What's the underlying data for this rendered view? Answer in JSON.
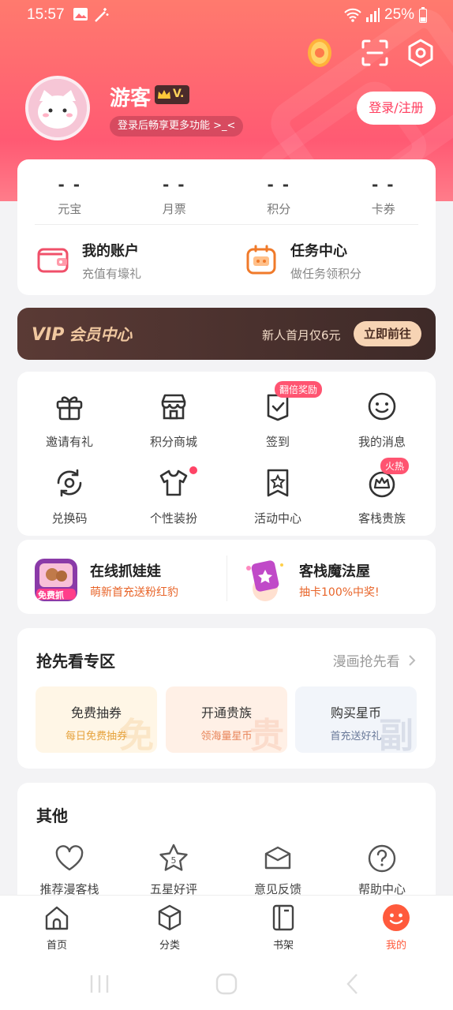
{
  "status": {
    "time": "15:57",
    "battery": "25%"
  },
  "profile": {
    "name": "游客",
    "vip_badge": "V.",
    "subtitle": "登录后畅享更多功能 >_<",
    "login_button": "登录/注册"
  },
  "stats": [
    {
      "value": "- -",
      "label": "元宝"
    },
    {
      "value": "- -",
      "label": "月票"
    },
    {
      "value": "- -",
      "label": "积分"
    },
    {
      "value": "- -",
      "label": "卡券"
    }
  ],
  "accounts": [
    {
      "title": "我的账户",
      "subtitle": "充值有壕礼"
    },
    {
      "title": "任务中心",
      "subtitle": "做任务领积分"
    }
  ],
  "vip": {
    "title": "会员中心",
    "logo": "VIP",
    "promo": "新人首月仅6元",
    "button": "立即前往"
  },
  "grid": [
    {
      "label": "邀请有礼",
      "icon": "gift-icon"
    },
    {
      "label": "积分商城",
      "icon": "store-icon"
    },
    {
      "label": "签到",
      "icon": "checkin-icon",
      "tag": "翻倍奖励"
    },
    {
      "label": "我的消息",
      "icon": "smile-message-icon"
    },
    {
      "label": "兑换码",
      "icon": "redeem-icon"
    },
    {
      "label": "个性装扮",
      "icon": "tshirt-icon"
    },
    {
      "label": "活动中心",
      "icon": "star-bookmark-icon"
    },
    {
      "label": "客栈贵族",
      "icon": "crown-icon",
      "tag": "火热"
    }
  ],
  "promos": [
    {
      "title": "在线抓娃娃",
      "subtitle": "萌新首充送粉红豹",
      "badge": "免费抓"
    },
    {
      "title": "客栈魔法屋",
      "subtitle": "抽卡100%中奖!"
    }
  ],
  "preview": {
    "title": "抢先看专区",
    "more": "漫画抢先看",
    "tiles": [
      {
        "title": "免费抽券",
        "subtitle": "每日免费抽券",
        "watermark": "免",
        "bg": "#fff6e6",
        "color": "#e6a23c"
      },
      {
        "title": "开通贵族",
        "subtitle": "领海量星币",
        "watermark": "贵",
        "bg": "#fff0e6",
        "color": "#e8855a"
      },
      {
        "title": "购买星币",
        "subtitle": "首充送好礼",
        "watermark": "副",
        "bg": "#f2f5fa",
        "color": "#6a7a9a"
      }
    ]
  },
  "other": {
    "title": "其他",
    "items": [
      {
        "label": "推荐漫客栈",
        "icon": "heart-icon"
      },
      {
        "label": "五星好评",
        "icon": "star-five-icon"
      },
      {
        "label": "意见反馈",
        "icon": "mail-icon"
      },
      {
        "label": "帮助中心",
        "icon": "help-icon"
      }
    ]
  },
  "nav": [
    {
      "label": "首页",
      "icon": "home-icon"
    },
    {
      "label": "分类",
      "icon": "cube-icon"
    },
    {
      "label": "书架",
      "icon": "book-icon"
    },
    {
      "label": "我的",
      "icon": "me-icon",
      "active": true
    }
  ],
  "colors": {
    "accent": "#ff5a73",
    "active_tab": "#ff5a3c",
    "vip_bg": "#3e2a28"
  }
}
